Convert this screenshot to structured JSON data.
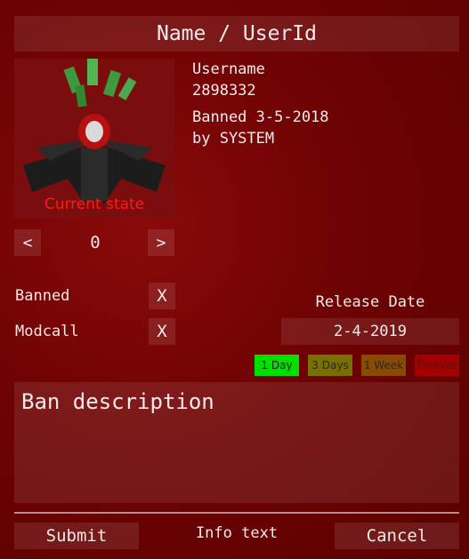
{
  "header": {
    "title": "Name / UserId"
  },
  "avatar": {
    "caption": "Current state",
    "accent": "#ff1a1a"
  },
  "user": {
    "username": "Username",
    "user_id": "2898332",
    "banned_line": "Banned 3-5-2018",
    "by_line": "by SYSTEM"
  },
  "nav": {
    "prev_label": "<",
    "next_label": ">",
    "count": "0"
  },
  "flags": [
    {
      "label": "Banned",
      "toggle": "X"
    },
    {
      "label": "Modcall",
      "toggle": "X"
    }
  ],
  "release": {
    "label": "Release Date",
    "date": "2-4-2019"
  },
  "durations": [
    {
      "label": "1 Day",
      "color": "#00e000",
      "text_color": "#2a2a2a"
    },
    {
      "label": "3 Days",
      "color": "#7a7000",
      "text_color": "#2a2a2a"
    },
    {
      "label": "1 Week",
      "color": "#8a4a00",
      "text_color": "#2a2a2a"
    },
    {
      "label": "Forever",
      "color": "#a50000",
      "text_color": "#5a1010"
    }
  ],
  "description": {
    "text": "Ban description"
  },
  "footer": {
    "submit_label": "Submit",
    "info_text": "Info text",
    "cancel_label": "Cancel"
  }
}
